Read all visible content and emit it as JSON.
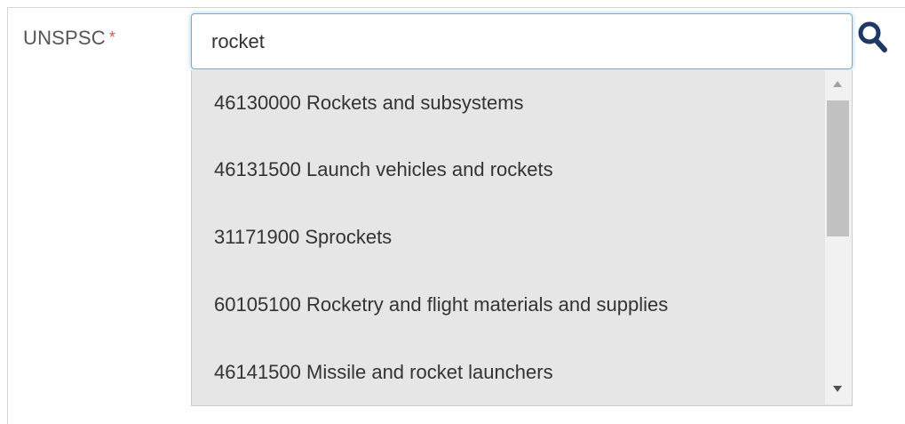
{
  "field": {
    "label": "UNSPSC",
    "required_marker": "*",
    "input_value": "rocket"
  },
  "search_button": {
    "icon": "search-icon",
    "color": "#1f3864"
  },
  "dropdown": {
    "background": "#e6e6e6",
    "options": [
      {
        "label": "46130000 Rockets and subsystems"
      },
      {
        "label": "46131500 Launch vehicles and rockets"
      },
      {
        "label": "31171900 Sprockets"
      },
      {
        "label": "60105100 Rocketry and flight materials and supplies"
      },
      {
        "label": "46141500 Missile and rocket launchers"
      }
    ]
  },
  "colors": {
    "required": "#d9534f",
    "focus_border": "#66afe9"
  }
}
